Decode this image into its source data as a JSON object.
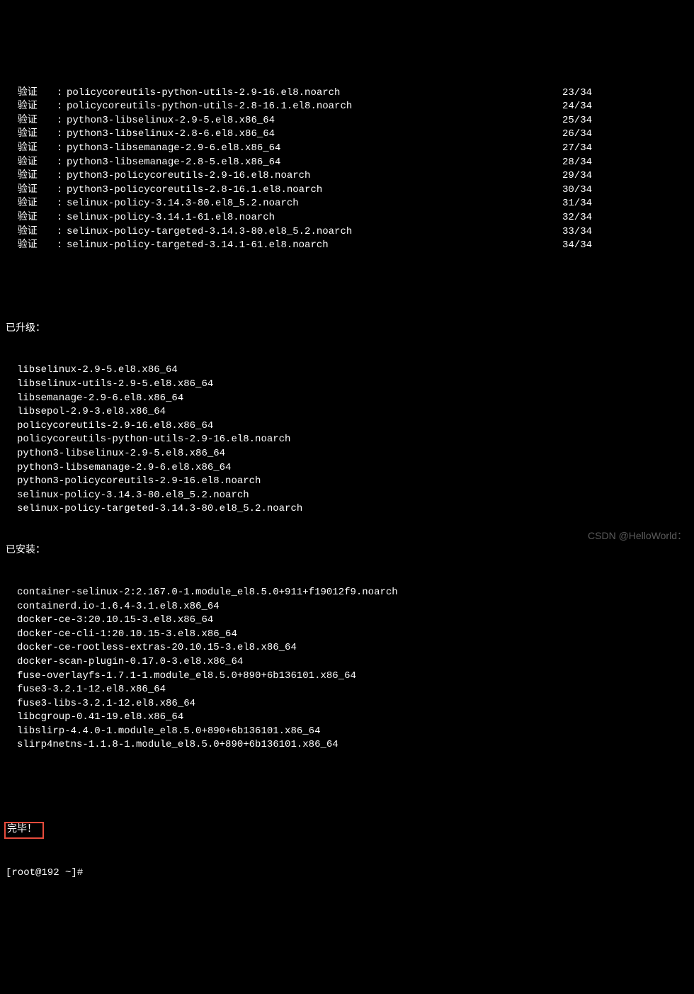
{
  "verify_label": "验证",
  "colon": ":",
  "verify_rows": [
    {
      "pkg": "policycoreutils-python-utils-2.9-16.el8.noarch",
      "count": "23/34"
    },
    {
      "pkg": "policycoreutils-python-utils-2.8-16.1.el8.noarch",
      "count": "24/34"
    },
    {
      "pkg": "python3-libselinux-2.9-5.el8.x86_64",
      "count": "25/34"
    },
    {
      "pkg": "python3-libselinux-2.8-6.el8.x86_64",
      "count": "26/34"
    },
    {
      "pkg": "python3-libsemanage-2.9-6.el8.x86_64",
      "count": "27/34"
    },
    {
      "pkg": "python3-libsemanage-2.8-5.el8.x86_64",
      "count": "28/34"
    },
    {
      "pkg": "python3-policycoreutils-2.9-16.el8.noarch",
      "count": "29/34"
    },
    {
      "pkg": "python3-policycoreutils-2.8-16.1.el8.noarch",
      "count": "30/34"
    },
    {
      "pkg": "selinux-policy-3.14.3-80.el8_5.2.noarch",
      "count": "31/34"
    },
    {
      "pkg": "selinux-policy-3.14.1-61.el8.noarch",
      "count": "32/34"
    },
    {
      "pkg": "selinux-policy-targeted-3.14.3-80.el8_5.2.noarch",
      "count": "33/34"
    },
    {
      "pkg": "selinux-policy-targeted-3.14.1-61.el8.noarch",
      "count": "34/34"
    }
  ],
  "upgraded_header": "已升级：",
  "upgraded": [
    "libselinux-2.9-5.el8.x86_64",
    "libselinux-utils-2.9-5.el8.x86_64",
    "libsemanage-2.9-6.el8.x86_64",
    "libsepol-2.9-3.el8.x86_64",
    "policycoreutils-2.9-16.el8.x86_64",
    "policycoreutils-python-utils-2.9-16.el8.noarch",
    "python3-libselinux-2.9-5.el8.x86_64",
    "python3-libsemanage-2.9-6.el8.x86_64",
    "python3-policycoreutils-2.9-16.el8.noarch",
    "selinux-policy-3.14.3-80.el8_5.2.noarch",
    "selinux-policy-targeted-3.14.3-80.el8_5.2.noarch"
  ],
  "installed_header": "已安装：",
  "installed": [
    "container-selinux-2:2.167.0-1.module_el8.5.0+911+f19012f9.noarch",
    "containerd.io-1.6.4-3.1.el8.x86_64",
    "docker-ce-3:20.10.15-3.el8.x86_64",
    "docker-ce-cli-1:20.10.15-3.el8.x86_64",
    "docker-ce-rootless-extras-20.10.15-3.el8.x86_64",
    "docker-scan-plugin-0.17.0-3.el8.x86_64",
    "fuse-overlayfs-1.7.1-1.module_el8.5.0+890+6b136101.x86_64",
    "fuse3-3.2.1-12.el8.x86_64",
    "fuse3-libs-3.2.1-12.el8.x86_64",
    "libcgroup-0.41-19.el8.x86_64",
    "libslirp-4.4.0-1.module_el8.5.0+890+6b136101.x86_64",
    "slirp4netns-1.1.8-1.module_el8.5.0+890+6b136101.x86_64"
  ],
  "done": "完毕！",
  "prompt": "[root@192 ~]#",
  "watermark": "CSDN @HelloWorld："
}
